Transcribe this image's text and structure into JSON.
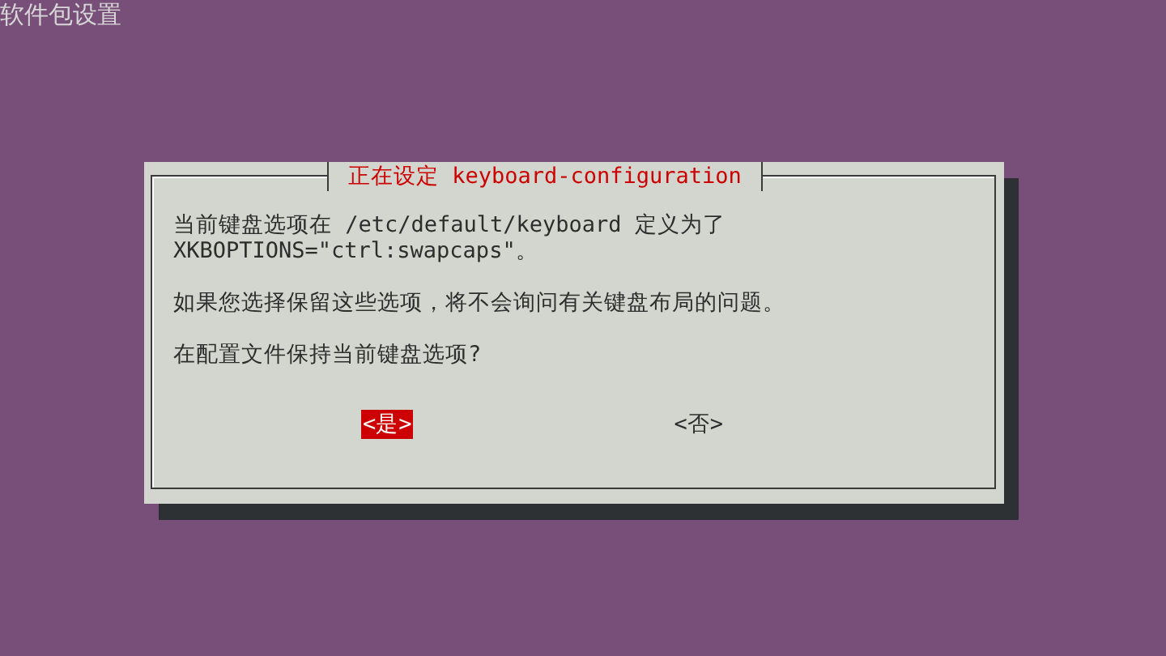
{
  "screen_title": "软件包设置",
  "dialog": {
    "title": "正在设定 keyboard-configuration",
    "paragraphs": [
      "当前键盘选项在 /etc/default/keyboard 定义为了\nXKBOPTIONS=\"ctrl:swapcaps\"。",
      "如果您选择保留这些选项，将不会询问有关键盘布局的问题。",
      "在配置文件保持当前键盘选项?"
    ],
    "buttons": [
      {
        "label": "<是>",
        "selected": true
      },
      {
        "label": "<否>",
        "selected": false
      }
    ]
  }
}
